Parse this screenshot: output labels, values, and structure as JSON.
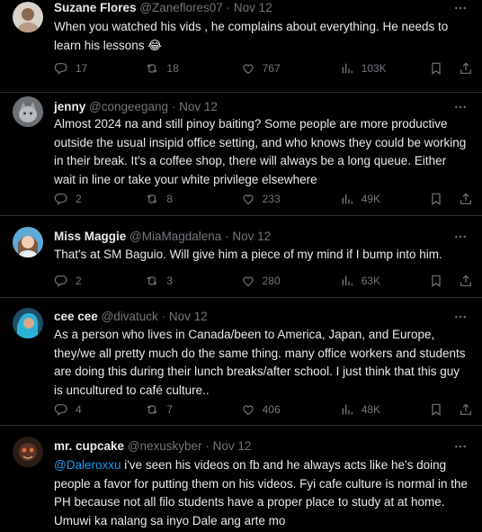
{
  "tweets": [
    {
      "name": "Suzane Flores",
      "handle": "@Zaneflores07",
      "sep": "·",
      "date": "Nov 12",
      "text": "When you watched his vids , he complains about everything. He needs to learn his lessons 😂",
      "replies": "17",
      "retweets": "18",
      "likes": "767",
      "views": "103K"
    },
    {
      "name": "jenny",
      "handle": "@congeegang",
      "sep": "·",
      "date": "Nov 12",
      "text": "Almost 2024 na and still pinoy baiting? Some people are more productive outside the usual insipid office setting, and who knows they could be working in their break. It's a coffee shop, there will always be a long queue. Either wait in line or take your white privilege elsewhere",
      "replies": "2",
      "retweets": "8",
      "likes": "233",
      "views": "49K"
    },
    {
      "name": "Miss Maggie",
      "handle": "@MiaMagdalena",
      "sep": "·",
      "date": "Nov 12",
      "text": "That's at SM Baguio. Will give him a piece of my mind if I bump into him.",
      "replies": "2",
      "retweets": "3",
      "likes": "280",
      "views": "63K"
    },
    {
      "name": "cee cee",
      "handle": "@divatuck",
      "sep": "·",
      "date": "Nov 12",
      "text": "As a person who lives in Canada/been to America, Japan, and Europe, they/we all pretty much do the same thing. many office workers and students are doing this during their lunch breaks/after school. I just think that this guy is uncultured to café culture..",
      "replies": "4",
      "retweets": "7",
      "likes": "406",
      "views": "48K"
    },
    {
      "name": "mr. cupcake",
      "handle": "@nexuskyber",
      "sep": "·",
      "date": "Nov 12",
      "mention": "@Daleroxxu",
      "text": " i've seen his videos on fb and he always acts like he's doing people a favor for putting them on his videos. Fyi cafe culture is normal in the PH because not all filo students have a proper place to study at at home. Umuwi ka nalang sa inyo Dale ang arte mo"
    }
  ],
  "colors": {
    "background": "#000000",
    "text": "#e7e9ea",
    "secondary": "#71767b",
    "divider": "#2f3336",
    "link": "#1d9bf0"
  },
  "icons": [
    "more-icon",
    "reply-icon",
    "retweet-icon",
    "like-icon",
    "views-icon",
    "bookmark-icon",
    "share-icon"
  ]
}
